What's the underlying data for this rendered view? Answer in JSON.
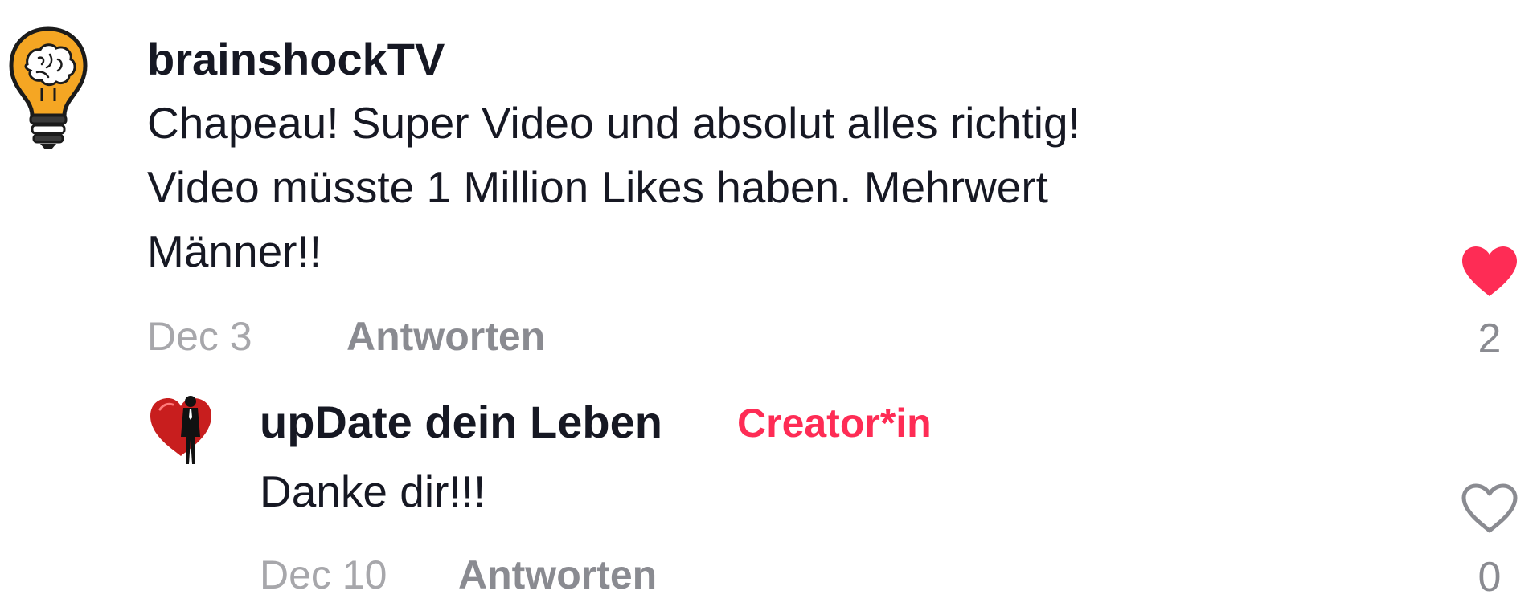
{
  "comment": {
    "author": "brainshockTV",
    "avatar_icon": "brain-lightbulb-icon",
    "text": "Chapeau! Super Video und absolut alles richtig!\nVideo müsste 1 Million Likes haben. Mehrwert\nMänner!!",
    "date": "Dec 3",
    "reply_label": "Antworten",
    "like_count": "2",
    "liked": true,
    "like_icon": "heart-filled-icon"
  },
  "reply": {
    "author": "upDate dein Leben",
    "badge": "Creator*in",
    "avatar_icon": "heart-man-avatar-icon",
    "text": "Danke dir!!!",
    "date": "Dec 10",
    "reply_label": "Antworten",
    "like_count": "0",
    "liked": false,
    "like_icon": "heart-outline-icon"
  },
  "colors": {
    "accent": "#fe2c55",
    "text_primary": "#161823",
    "text_secondary": "#8a8b91",
    "text_tertiary": "#a7a7ab"
  }
}
